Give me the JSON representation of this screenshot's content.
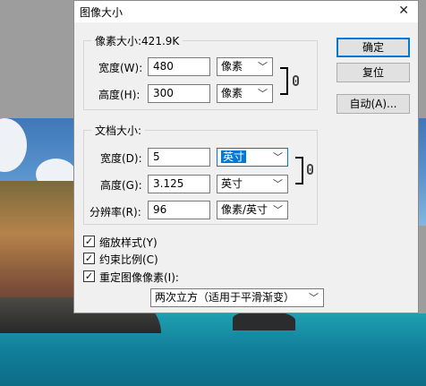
{
  "dialog": {
    "title": "图像大小",
    "close_glyph": "✕"
  },
  "pixel_dimensions": {
    "legend": "像素大小:421.9K",
    "width_label": "宽度(W):",
    "width_value": "480",
    "width_unit": "像素",
    "height_label": "高度(H):",
    "height_value": "300",
    "height_unit": "像素"
  },
  "document_size": {
    "legend": "文档大小:",
    "width_label": "宽度(D):",
    "width_value": "5",
    "width_unit": "英寸",
    "height_label": "高度(G):",
    "height_value": "3.125",
    "height_unit": "英寸",
    "resolution_label": "分辨率(R):",
    "resolution_value": "96",
    "resolution_unit": "像素/英寸"
  },
  "buttons": {
    "ok": "确定",
    "reset": "复位",
    "auto": "自动(A)..."
  },
  "options": {
    "scale_styles": {
      "label": "缩放样式(Y)",
      "checked": true
    },
    "constrain_proportions": {
      "label": "约束比例(C)",
      "checked": true
    },
    "resample_image": {
      "label": "重定图像像素(I):",
      "checked": true
    },
    "resample_method": "两次立方（适用于平滑渐变）"
  },
  "icons": {
    "check": "✓",
    "dropdown": "﹀",
    "link": "link-icon"
  }
}
